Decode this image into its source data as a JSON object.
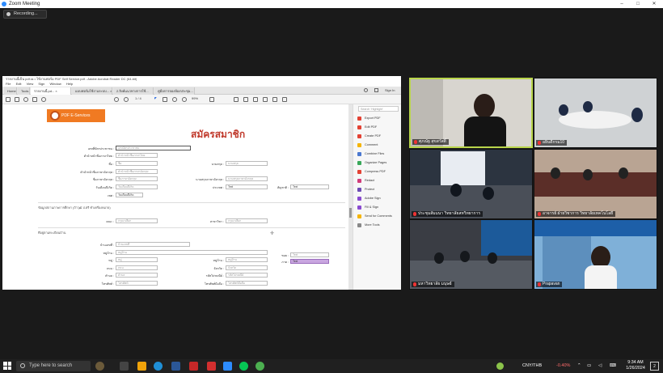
{
  "window": {
    "title": "Zoom Meeting",
    "minimize": "–",
    "maximize": "□",
    "close": "✕"
  },
  "recording": {
    "label": "Recording..."
  },
  "acrobat": {
    "title": "รายงานนี้เป็น pdf.ra • ใช้งานฟอร์ม PDF Self Service.pdf - Adobe Acrobat Reader DC (64-bit)",
    "menu": [
      "File",
      "Edit",
      "View",
      "Sign",
      "Window",
      "Help"
    ],
    "tabs": [
      "Home",
      "Tools",
      "รายงานนี้.pd... ×",
      "แบบฟอร์มใช้งานระบบ... ×",
      "2.ลิงค์แนวทางการใช้...",
      "คู่มือการจองห้องประชุม..."
    ],
    "page": "1 / 4",
    "zoom": "99%",
    "signin": "Sign In",
    "search_placeholder": "Search 'Highlight'",
    "tools": [
      "Export PDF",
      "Edit PDF",
      "Create PDF",
      "Comment",
      "Combine Files",
      "Organize Pages",
      "Compress PDF",
      "Redact",
      "Protect",
      "Adobe Sign",
      "Fill & Sign",
      "Send for Comments",
      "More Tools"
    ]
  },
  "form": {
    "banner": "PDF E-Services",
    "title": "สมัครสมาชิก",
    "labels": {
      "username": "เลขที่บัตรประชาชน :",
      "prefix": "คำนำหน้าชื่อภาษาไทย :",
      "name": "ชื่อ :",
      "lastname": "นามสกุล :",
      "prefix_en": "คำนำหน้าชื่อภาษาอังกฤษ :",
      "name_en": "ชื่อภาษาอังกฤษ :",
      "lastname_en": "นามสกุลภาษาอังกฤษ :",
      "birthdate": "วันเดือนปีเกิด :",
      "gender": "เพศ :",
      "nationality": "ประเทศ :",
      "religion": "สัญชาติ :",
      "section1": "ข้อมูลสถานภาพการศึกษา (ถ้าวุฒิ ป.ตรี ทำเครื่องหมาย)",
      "faculty": "คณะ :",
      "major": "สาขาวิชา :",
      "section2": "ที่อยู่ตามทะเบียนบ้าน",
      "house": "บ้านเลขที่ :",
      "village": "หมู่บ้าน :",
      "moo": "หมู่ :",
      "road": "ถนน :",
      "subdistrict": "ตำบล :",
      "district": "อำเภอ :",
      "province": "จังหวัด :",
      "postcode": "รหัสไปรษณีย์ :",
      "phone": "โทรศัพท์ :",
      "mobile": "โทรศัพท์มือถือ :",
      "soi": "ซอย :",
      "zone": "ภาค :"
    },
    "values": {
      "username": "เลขบัตรประชาชน",
      "prefix": "คำนำหน้าชื่อภาษาไทย",
      "name": "ชื่อ",
      "lastname": "นามสกุล",
      "prefix_en": "คำนำหน้าชื่อภาษาอังกฤษ",
      "name_en": "ชื่อภาษาอังกฤษ",
      "lastname_en": "นามสกุลภาษาอังกฤษ",
      "birthdate": "วันเดือนปีเกิด",
      "gender": "Text",
      "religion": "Text",
      "faculty": "กรุณาเลือก",
      "major": "กรุณาเลือก",
      "house": "บ้านเลขที่",
      "village": "หมู่บ้าน",
      "moo": "หมู่",
      "road": "ถนน",
      "subdistrict": "ตำบล",
      "district": "อำเภอ",
      "province": "จังหวัด",
      "postcode": "รหัสไปรษณีย์",
      "phone": "โทรศัพท์",
      "mobile": "โทรศัพท์มือถือ",
      "soi": "Text",
      "zone": "Text",
      "date_btn": "วันเดือนปีเกิด"
    }
  },
  "participants": [
    {
      "name": "ศุภณัฐ สุขสวัสดิ์"
    },
    {
      "name": "อธิบดีกรม10"
    },
    {
      "name": "ประชุมสัมมนา วิทยาลัยสหวิทยาการ"
    },
    {
      "name": "อาจารย์ ฝ่ายวิชาการ วิทยาลัยเทคโนโลยี"
    },
    {
      "name": "มหาวิทยาลัย มนุษย์"
    },
    {
      "name": "Prapavan"
    }
  ],
  "taskbar": {
    "search_placeholder": "Type here to search",
    "currency": "CNY/THB",
    "change": "-0.40%",
    "time": "9:34 AM",
    "date": "1/26/2024",
    "notifications": "2"
  }
}
